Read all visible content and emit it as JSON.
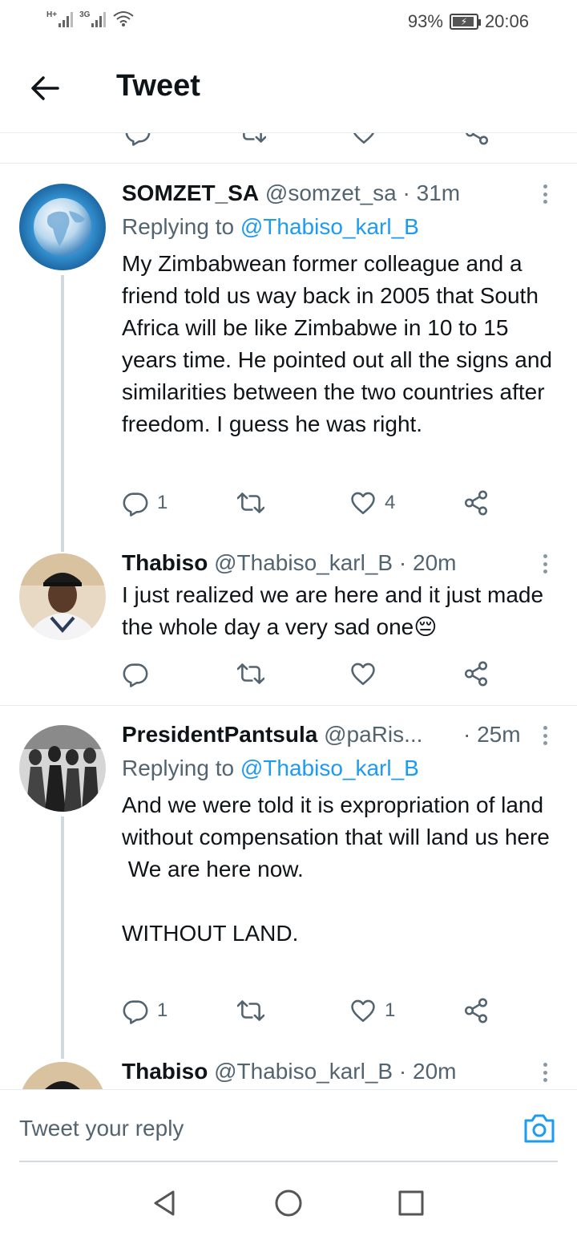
{
  "status_bar": {
    "net1": "H+",
    "net2": "3G",
    "battery_percent": "93%",
    "time": "20:06"
  },
  "header": {
    "title": "Tweet",
    "back_icon": "arrow-left-icon"
  },
  "tweets": [
    {
      "name": "SOMZET_SA",
      "handle": "@somzet_sa",
      "time": "· 31m",
      "replying_prefix": "Replying to ",
      "replying_to": "@Thabiso_karl_B",
      "text": "My Zimbabwean former colleague and a friend told us way back in 2005 that South Africa will be like Zimbabwe in 10 to 15 years time. He pointed out all the signs and similarities between the two countries after freedom. I guess he was right.",
      "replies": "1",
      "likes": "4"
    },
    {
      "name": "Thabiso",
      "handle": "@Thabiso_karl_B",
      "time": "· 20m",
      "text": "I just realized we are here and it just made the whole day a very sad one",
      "emoji": "😔"
    },
    {
      "name": "PresidentPantsula",
      "handle": "@paRis...",
      "time": "· 25m",
      "replying_prefix": "Replying to ",
      "replying_to": "@Thabiso_karl_B",
      "text": "And we were told it is expropriation of land without compensation that will land us here\n We are here now.\n\nWITHOUT LAND.",
      "replies": "1",
      "likes": "1"
    },
    {
      "name": "Thabiso",
      "handle": "@Thabiso_karl_B",
      "time": "· 20m"
    }
  ],
  "reply_bar": {
    "placeholder": "Tweet your reply",
    "camera_icon": "camera-icon"
  },
  "colors": {
    "accent": "#1d9bf0",
    "text": "#0f1419",
    "secondary": "#536471",
    "divider": "#e6ecf0",
    "thread_line": "#cfd9de"
  }
}
